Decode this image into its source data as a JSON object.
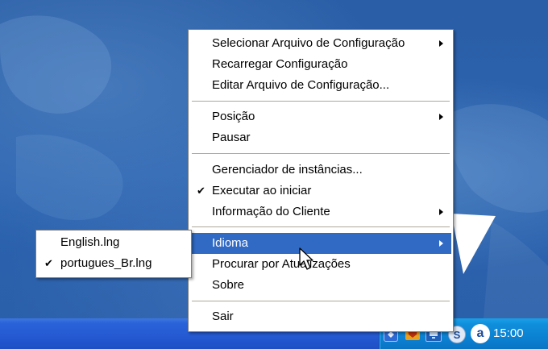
{
  "main_menu": {
    "items": [
      {
        "label": "Selecionar Arquivo de Configuração",
        "submenu": true
      },
      {
        "label": "Recarregar Configuração"
      },
      {
        "label": "Editar Arquivo de Configuração..."
      },
      {
        "label": "Posição",
        "submenu": true
      },
      {
        "label": "Pausar"
      },
      {
        "label": "Gerenciador de instâncias..."
      },
      {
        "label": "Executar ao iniciar",
        "checked": true
      },
      {
        "label": "Informação do Cliente",
        "submenu": true
      },
      {
        "label": "Idioma",
        "submenu": true,
        "highlighted": true
      },
      {
        "label": "Procurar por Atualizações"
      },
      {
        "label": "Sobre"
      },
      {
        "label": "Sair"
      }
    ]
  },
  "language_submenu": {
    "items": [
      {
        "label": "English.lng"
      },
      {
        "label": "portugues_Br.lng",
        "checked": true
      }
    ]
  },
  "taskbar": {
    "clock": "15:00",
    "tray_icons": [
      "network-icon",
      "shield-icon",
      "monitor-icon",
      "s-app-icon",
      "a-app-icon"
    ]
  },
  "glyphs": {
    "check": "✔"
  },
  "colors": {
    "highlight": "#316ac5",
    "desktop": "#2c64b0",
    "taskbar": "#2459d2",
    "tray": "#0f8edc"
  }
}
